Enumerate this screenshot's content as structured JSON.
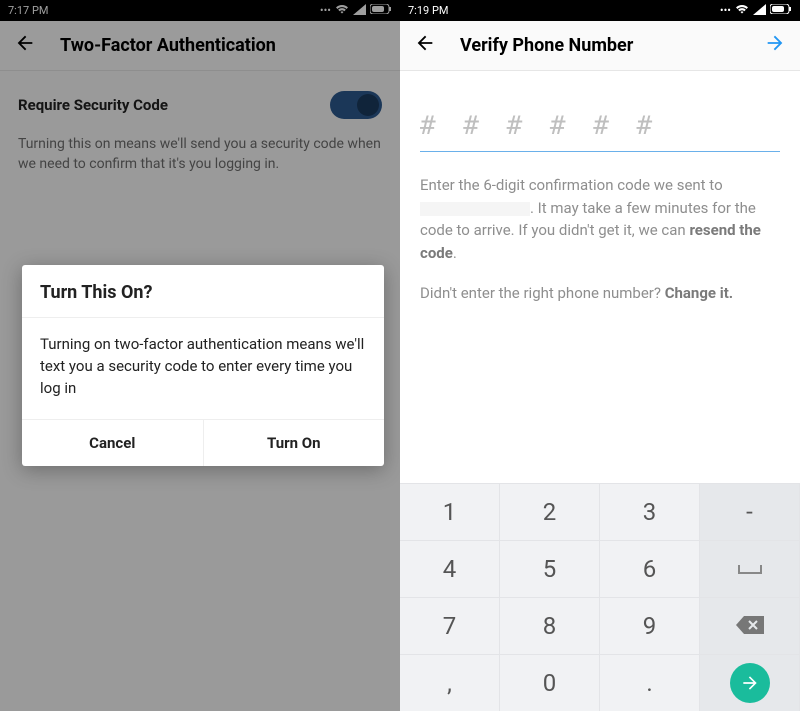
{
  "left": {
    "status": {
      "time": "7:17 PM"
    },
    "header": {
      "title": "Two-Factor Authentication"
    },
    "setting": {
      "label": "Require Security Code",
      "desc": "Turning this on means we'll send you a security code when we need to confirm that it's you logging in."
    },
    "dialog": {
      "title": "Turn This On?",
      "body": "Turning on two-factor authentication means we'll text you a security code to enter every time you log in",
      "cancel": "Cancel",
      "confirm": "Turn On"
    }
  },
  "right": {
    "status": {
      "time": "7:19 PM"
    },
    "header": {
      "title": "Verify Phone Number"
    },
    "code_placeholder": "# # #   # # #",
    "help_pre": "Enter the 6-digit confirmation code we sent to ",
    "help_post": ". It may take a few minutes for the code to arrive. If you didn't get it, we can ",
    "help_link": "resend the code",
    "help_period": ".",
    "change_pre": "Didn't enter the right phone number? ",
    "change_link": "Change it.",
    "keypad": {
      "k1": "1",
      "k2": "2",
      "k3": "3",
      "kdash": "-",
      "k4": "4",
      "k5": "5",
      "k6": "6",
      "k7": "7",
      "k8": "8",
      "k9": "9",
      "kcomma": ",",
      "k0": "0",
      "kdot": "."
    }
  }
}
